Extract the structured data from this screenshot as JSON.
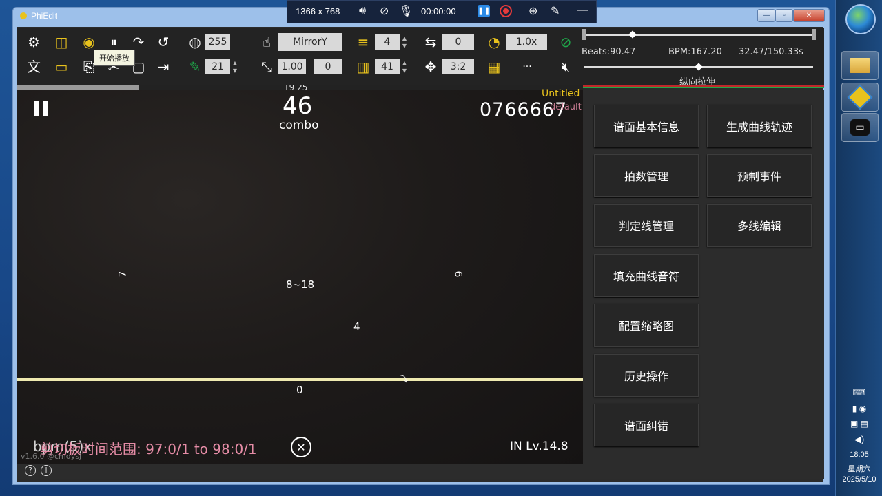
{
  "window": {
    "title": "PhiEdit"
  },
  "recorder": {
    "resolution": "1366 x 768",
    "time": "00:00:00"
  },
  "toolbar": {
    "tooltip": "开始播放",
    "alpha_value": "255",
    "mirror_value": "MirrorY",
    "lines_value": "4",
    "offset_value": "0",
    "speed_value": "1.0x",
    "note_size_value": "21",
    "scale_value": "1.00",
    "scale_offset_value": "0",
    "density_value": "41",
    "ratio_value": "3:2",
    "more_label": "···"
  },
  "timeline": {
    "beats_label": "Beats:90.47",
    "bpm_label": "BPM:167.20",
    "time_label": "32.47/150.33s",
    "stretch_label": "纵向拉伸"
  },
  "preview": {
    "combo_top": "19 25",
    "combo_number": "46",
    "combo_label": "combo",
    "score": "0766667",
    "chart_name": "Untitled",
    "difficulty_overlay": "default",
    "line_label_left": "7",
    "line_label_center": "8~18",
    "line_label_right": "6",
    "line_label_mid": "4",
    "line_label_zero": "0",
    "range_text": "剪切板时间范围: 97:0/1 to 98:0/1",
    "range_overlay": "bpm(5)x",
    "level": "IN Lv.14.8",
    "version": "v1.6.0 @cmdysj"
  },
  "menu": {
    "items": [
      "谱面基本信息",
      "生成曲线轨迹",
      "拍数管理",
      "预制事件",
      "判定线管理",
      "多线编辑",
      "填充曲线音符",
      "配置缩略图",
      "历史操作",
      "谱面纠错"
    ]
  },
  "taskbar": {
    "time": "18:05",
    "weekday": "星期六",
    "date": "2025/5/10"
  },
  "colors": {
    "accent_yellow": "#e8c21d",
    "judge_line": "#efeab0",
    "chart_name": "#e8c21d",
    "overlay_pink": "#e58ca6",
    "green_line": "#1fa84a",
    "red_line": "#c0282a"
  }
}
